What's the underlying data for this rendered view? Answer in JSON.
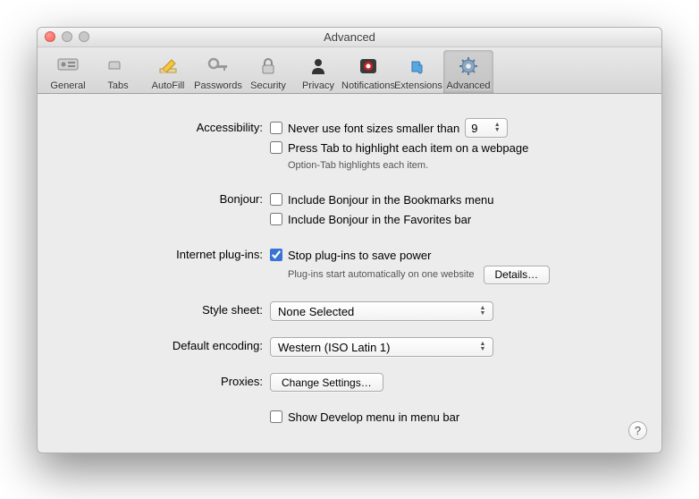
{
  "window": {
    "title": "Advanced"
  },
  "toolbar": {
    "items": [
      {
        "label": "General"
      },
      {
        "label": "Tabs"
      },
      {
        "label": "AutoFill"
      },
      {
        "label": "Passwords"
      },
      {
        "label": "Security"
      },
      {
        "label": "Privacy"
      },
      {
        "label": "Notifications"
      },
      {
        "label": "Extensions"
      },
      {
        "label": "Advanced"
      }
    ]
  },
  "sections": {
    "accessibility": {
      "label": "Accessibility:",
      "fontSize": "Never use font sizes smaller than",
      "fontSizeValue": "9",
      "pressTab": "Press Tab to highlight each item on a webpage",
      "helper": "Option-Tab highlights each item."
    },
    "bonjour": {
      "label": "Bonjour:",
      "bookmarks": "Include Bonjour in the Bookmarks menu",
      "favorites": "Include Bonjour in the Favorites bar"
    },
    "plugins": {
      "label": "Internet plug-ins:",
      "stop": "Stop plug-ins to save power",
      "helper": "Plug-ins start automatically on one website",
      "details": "Details…"
    },
    "stylesheet": {
      "label": "Style sheet:",
      "value": "None Selected"
    },
    "encoding": {
      "label": "Default encoding:",
      "value": "Western (ISO Latin 1)"
    },
    "proxies": {
      "label": "Proxies:",
      "button": "Change Settings…"
    },
    "develop": {
      "label": "Show Develop menu in menu bar"
    }
  },
  "help": "?"
}
